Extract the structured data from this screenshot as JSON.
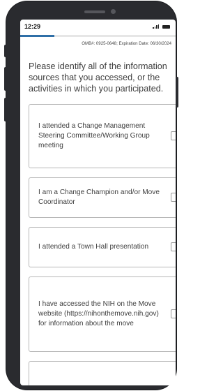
{
  "status_bar": {
    "time": "12:29",
    "signal_icon": "cell-signal-icon",
    "battery_icon": "battery-icon"
  },
  "progress": {
    "value_percent": 22,
    "color": "#2f6fa7"
  },
  "omb_notice": "OMB#: 0925-0648; Expiration Date: 06/30/2024",
  "question": "Please identify all of the information sources that you accessed, or the activities in which you participated.",
  "options": [
    {
      "label": "I attended a Change Management Steering Committee/Working Group meeting",
      "checked": false
    },
    {
      "label": "I am a Change Champion and/or Move Coordinator",
      "checked": false
    },
    {
      "label": "I attended a Town Hall presentation",
      "checked": false
    },
    {
      "label": "I have accessed the NIH on the Move website (https://nihonthemove.nih.gov) for information about the move",
      "checked": false
    },
    {
      "label": "",
      "checked": false
    }
  ]
}
